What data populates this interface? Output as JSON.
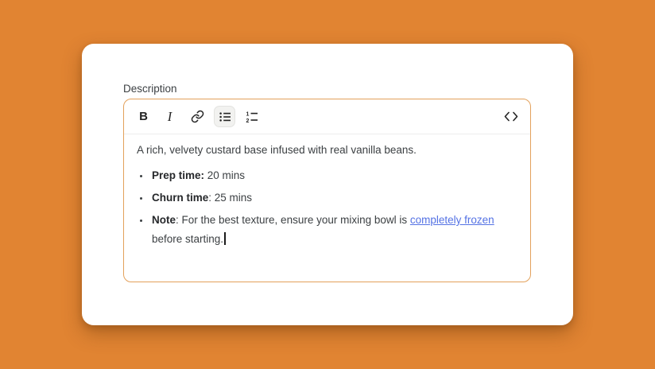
{
  "window": {
    "background_color": "#E18432"
  },
  "form": {
    "label": "Description"
  },
  "toolbar": {
    "bold": {
      "glyph": "B",
      "icon": "bold-icon",
      "active": false
    },
    "italic": {
      "glyph": "I",
      "icon": "italic-icon",
      "active": false
    },
    "link": {
      "icon": "chain-link-icon",
      "active": false
    },
    "bullet_list": {
      "icon": "bulleted-list-icon",
      "active": true
    },
    "ordered_list": {
      "icon": "numbered-list-icon",
      "active": false,
      "digits": [
        "1",
        "2"
      ]
    },
    "code_view": {
      "icon": "angle-brackets-icon",
      "active": false
    }
  },
  "editor": {
    "paragraph": "A rich, velvety custard base infused with real vanilla beans.",
    "list": [
      {
        "bold": "Prep time:",
        "text": " 20 mins"
      },
      {
        "bold": "Churn time",
        "text": ": 25 mins"
      },
      {
        "bold": "Note",
        "text_before_link": ": For the best texture, ensure your mixing bowl is ",
        "link_text": "completely frozen",
        "text_after_link": " before starting."
      }
    ],
    "caret_visible": true
  },
  "colors": {
    "background": "#E18432",
    "card": "#FFFFFF",
    "editor_border": "#E3A15B",
    "toolbar_divider": "#ECECEC",
    "active_button_bg": "#F2F2F0",
    "active_button_border": "#E3E3E0",
    "text": "#3C4043",
    "bold_text": "#26282B",
    "link": "#5472E4",
    "icon": "#232323"
  }
}
